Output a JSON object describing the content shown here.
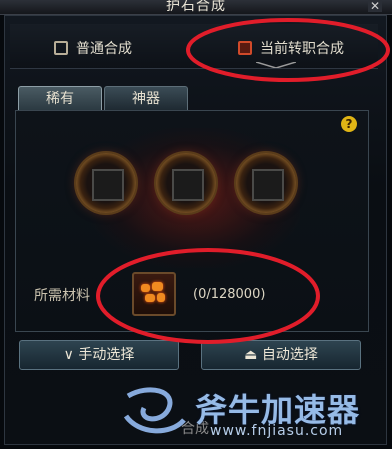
{
  "window": {
    "title": "护石合成",
    "close_icon": "close-icon"
  },
  "top_tabs": [
    {
      "label": "普通合成",
      "icon": "slot-icon",
      "active": false
    },
    {
      "label": "当前转职合成",
      "icon": "slot-icon-red",
      "active": true
    }
  ],
  "sub_tabs": [
    {
      "label": "稀有",
      "active": true
    },
    {
      "label": "神器",
      "active": false
    }
  ],
  "help_glyph": "?",
  "slots": [
    {
      "name": "talisman-slot-1"
    },
    {
      "name": "talisman-slot-2"
    },
    {
      "name": "talisman-slot-3"
    }
  ],
  "material": {
    "label": "所需材料",
    "icon": "material-ore-icon",
    "count": "(0/128000)"
  },
  "buttons": {
    "manual": "手动选择",
    "auto": "自动选择",
    "compose": "合成"
  },
  "watermark": {
    "text": "斧牛加速器",
    "url": "www.fnjiasu.com"
  },
  "colors": {
    "highlight": "#e11d2a",
    "accent_gold": "#e0b515"
  }
}
